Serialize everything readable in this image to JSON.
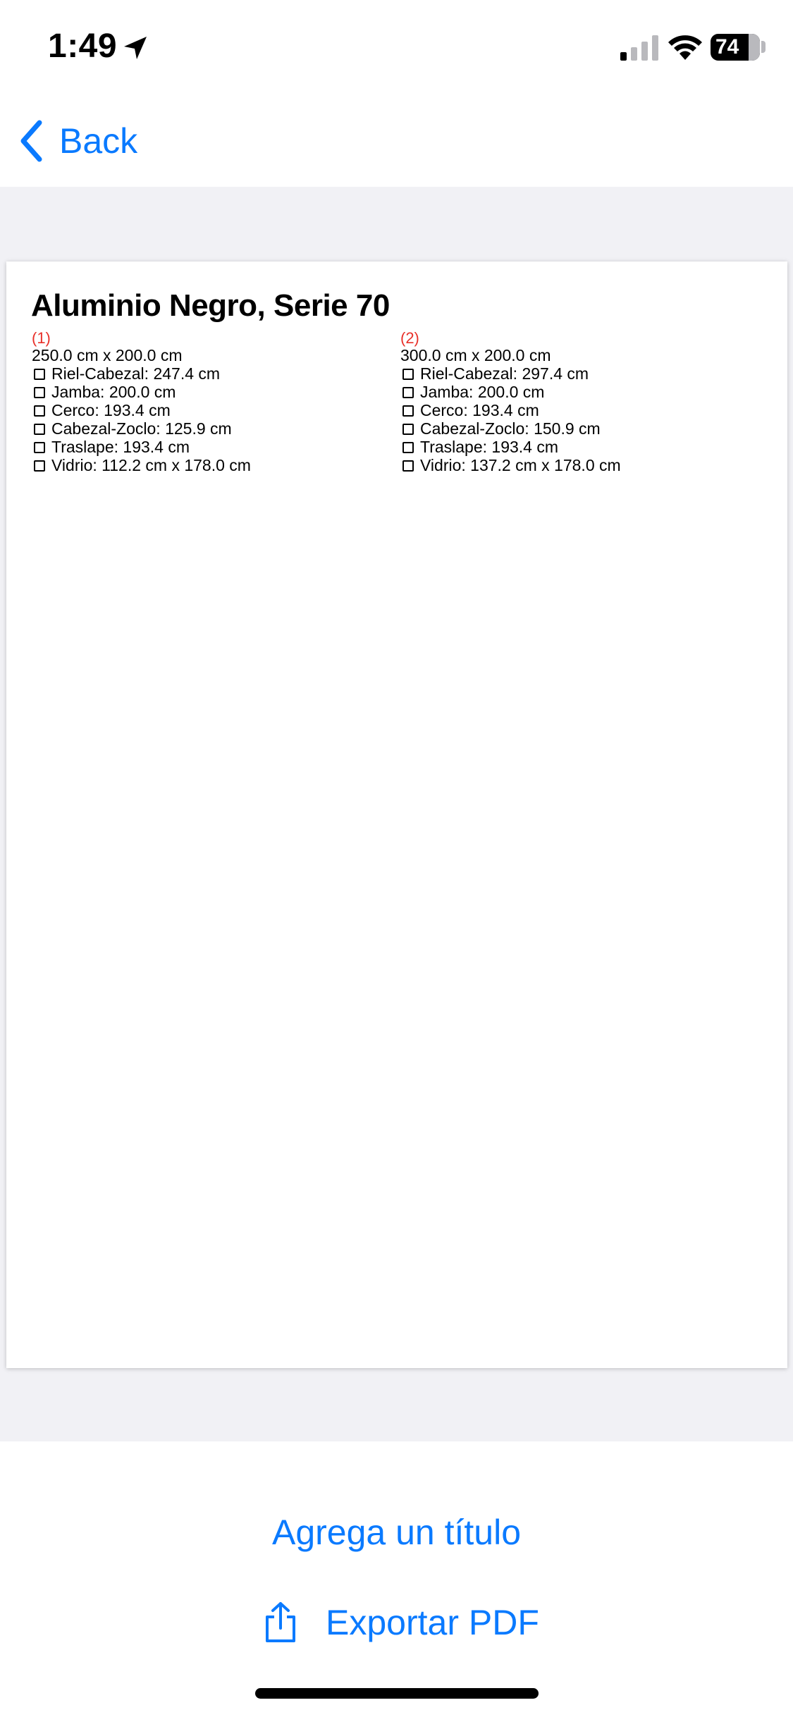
{
  "status_bar": {
    "time": "1:49",
    "battery_level": "74",
    "location_icon": "location-arrow-icon",
    "signal_icon": "cellular-signal-icon",
    "wifi_icon": "wifi-icon",
    "battery_icon": "battery-icon"
  },
  "nav": {
    "back_label": "Back",
    "back_icon": "chevron-left-icon"
  },
  "document": {
    "title": "Aluminio Negro, Serie 70",
    "windows": [
      {
        "number": "(1)",
        "size": "250.0 cm x 200.0 cm",
        "items": [
          "Riel-Cabezal: 247.4 cm",
          "Jamba: 200.0 cm",
          "Cerco: 193.4 cm",
          "Cabezal-Zoclo: 125.9 cm",
          "Traslape: 193.4 cm",
          "Vidrio: 112.2 cm x 178.0 cm"
        ]
      },
      {
        "number": "(2)",
        "size": "300.0 cm x 200.0 cm",
        "items": [
          "Riel-Cabezal: 297.4 cm",
          "Jamba: 200.0 cm",
          "Cerco: 193.4 cm",
          "Cabezal-Zoclo: 150.9 cm",
          "Traslape: 193.4 cm",
          "Vidrio: 137.2 cm x 178.0 cm"
        ]
      }
    ]
  },
  "actions": {
    "add_title_label": "Agrega un título",
    "export_label": "Exportar PDF",
    "export_icon": "share-icon"
  },
  "colors": {
    "accent": "#0a7aff",
    "number_red": "#e8312a",
    "preview_bg": "#f1f1f5"
  }
}
